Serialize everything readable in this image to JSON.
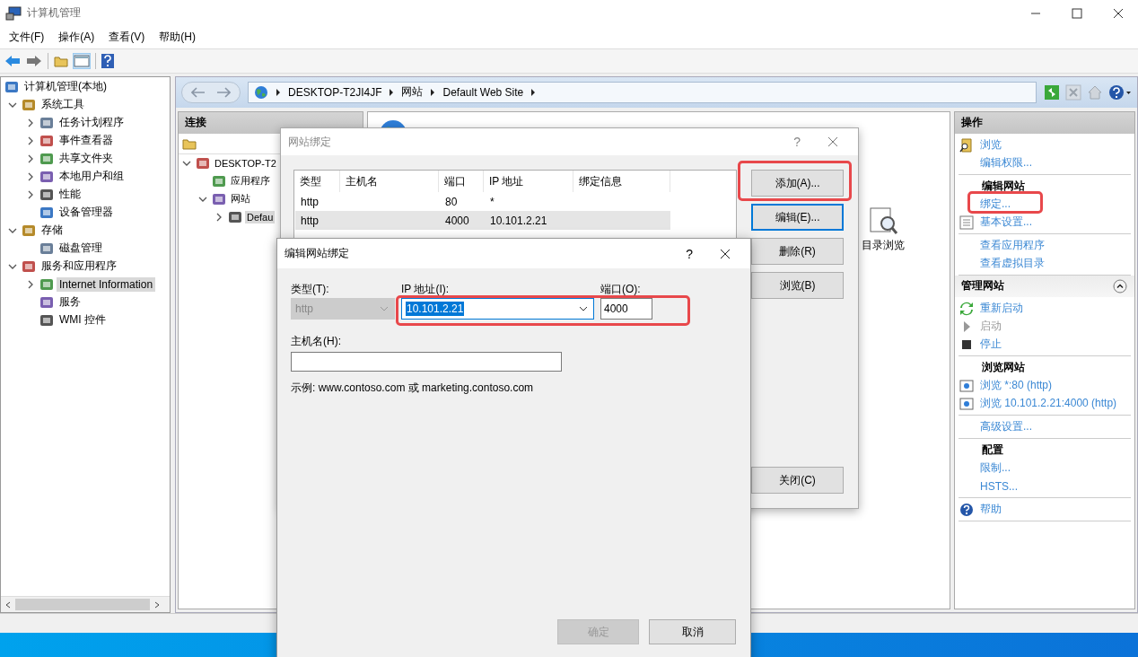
{
  "window": {
    "title": "计算机管理"
  },
  "menu": [
    "文件(F)",
    "操作(A)",
    "查看(V)",
    "帮助(H)"
  ],
  "tree": [
    {
      "label": "计算机管理(本地)",
      "selected": false,
      "children": [
        {
          "label": "系统工具",
          "expanded": true,
          "selected": false,
          "children": [
            {
              "label": "任务计划程序",
              "expanded": false,
              "selected": false
            },
            {
              "label": "事件查看器",
              "expanded": false,
              "selected": false
            },
            {
              "label": "共享文件夹",
              "expanded": false,
              "selected": false
            },
            {
              "label": "本地用户和组",
              "expanded": false,
              "selected": false
            },
            {
              "label": "性能",
              "expanded": false,
              "selected": false
            },
            {
              "label": "设备管理器",
              "selected": false
            }
          ]
        },
        {
          "label": "存储",
          "expanded": true,
          "selected": false,
          "children": [
            {
              "label": "磁盘管理",
              "selected": false
            }
          ]
        },
        {
          "label": "服务和应用程序",
          "expanded": true,
          "selected": false,
          "children": [
            {
              "label": "Internet Information",
              "expanded": false,
              "selected": true
            },
            {
              "label": "服务",
              "selected": false
            },
            {
              "label": "WMI 控件",
              "selected": false
            }
          ]
        }
      ]
    }
  ],
  "address": {
    "crumbs": [
      "DESKTOP-T2JI4JF",
      "网站",
      "Default Web Site"
    ]
  },
  "connections": {
    "title": "连接",
    "tree": [
      {
        "label": "DESKTOP-T2",
        "expanded": true,
        "selected": false,
        "children": [
          {
            "label": "应用程序",
            "selected": false
          },
          {
            "label": "网站",
            "expanded": true,
            "selected": false,
            "children": [
              {
                "label": "Defau",
                "expanded": false,
                "selected": true
              }
            ]
          }
        ]
      }
    ]
  },
  "center": {
    "feature": "目录浏览"
  },
  "actions": {
    "title": "操作",
    "sections": [
      {
        "kind": "links",
        "items": [
          {
            "label": "浏览",
            "disabled": false
          },
          {
            "label": "编辑权限...",
            "disabled": false
          }
        ]
      },
      {
        "kind": "links",
        "heading": "编辑网站",
        "items": [
          {
            "label": "绑定...",
            "disabled": false
          },
          {
            "label": "基本设置...",
            "disabled": false
          }
        ]
      },
      {
        "kind": "links",
        "items": [
          {
            "label": "查看应用程序",
            "disabled": false
          },
          {
            "label": "查看虚拟目录",
            "disabled": false
          }
        ]
      },
      {
        "kind": "group",
        "title": "管理网站",
        "expanded": true
      },
      {
        "kind": "links",
        "items": [
          {
            "label": "重新启动",
            "disabled": false
          },
          {
            "label": "启动",
            "disabled": true
          },
          {
            "label": "停止",
            "disabled": false
          }
        ]
      },
      {
        "kind": "links",
        "heading": "浏览网站",
        "items": [
          {
            "label": "浏览 *:80 (http)",
            "disabled": false
          },
          {
            "label": "浏览 10.101.2.21:4000 (http)",
            "disabled": false
          }
        ]
      },
      {
        "kind": "links",
        "items": [
          {
            "label": "高级设置...",
            "disabled": false
          }
        ]
      },
      {
        "kind": "links",
        "heading": "配置",
        "items": [
          {
            "label": "限制...",
            "disabled": false
          },
          {
            "label": "HSTS...",
            "disabled": false
          }
        ]
      },
      {
        "kind": "links",
        "items": [
          {
            "label": "帮助",
            "disabled": false
          }
        ]
      }
    ]
  },
  "bindings_dialog": {
    "title": "网站绑定",
    "help": "?",
    "columns": [
      "类型",
      "主机名",
      "端口",
      "IP 地址",
      "绑定信息"
    ],
    "rows": [
      {
        "type": "http",
        "port": "80",
        "ip": "*",
        "selected": false
      },
      {
        "type": "http",
        "port": "4000",
        "ip": "10.101.2.21",
        "selected": true
      }
    ],
    "buttons": [
      {
        "label": "添加(A)...",
        "focused": false
      },
      {
        "label": "编辑(E)...",
        "focused": true
      },
      {
        "label": "删除(R)",
        "focused": false
      },
      {
        "label": "浏览(B)",
        "focused": false
      }
    ],
    "close_button": "关闭(C)"
  },
  "edit_dialog": {
    "title": "编辑网站绑定",
    "help": "?",
    "type": {
      "label": "类型(T):",
      "value": "http",
      "disabled": true
    },
    "ip": {
      "label": "IP 地址(I):",
      "value": "10.101.2.21"
    },
    "port": {
      "label": "端口(O):",
      "value": "4000"
    },
    "host": {
      "label": "主机名(H):"
    },
    "example": "示例: www.contoso.com 或 marketing.contoso.com",
    "buttons": [
      {
        "label": "确定",
        "disabled": true
      },
      {
        "label": "取消",
        "disabled": false
      }
    ]
  }
}
